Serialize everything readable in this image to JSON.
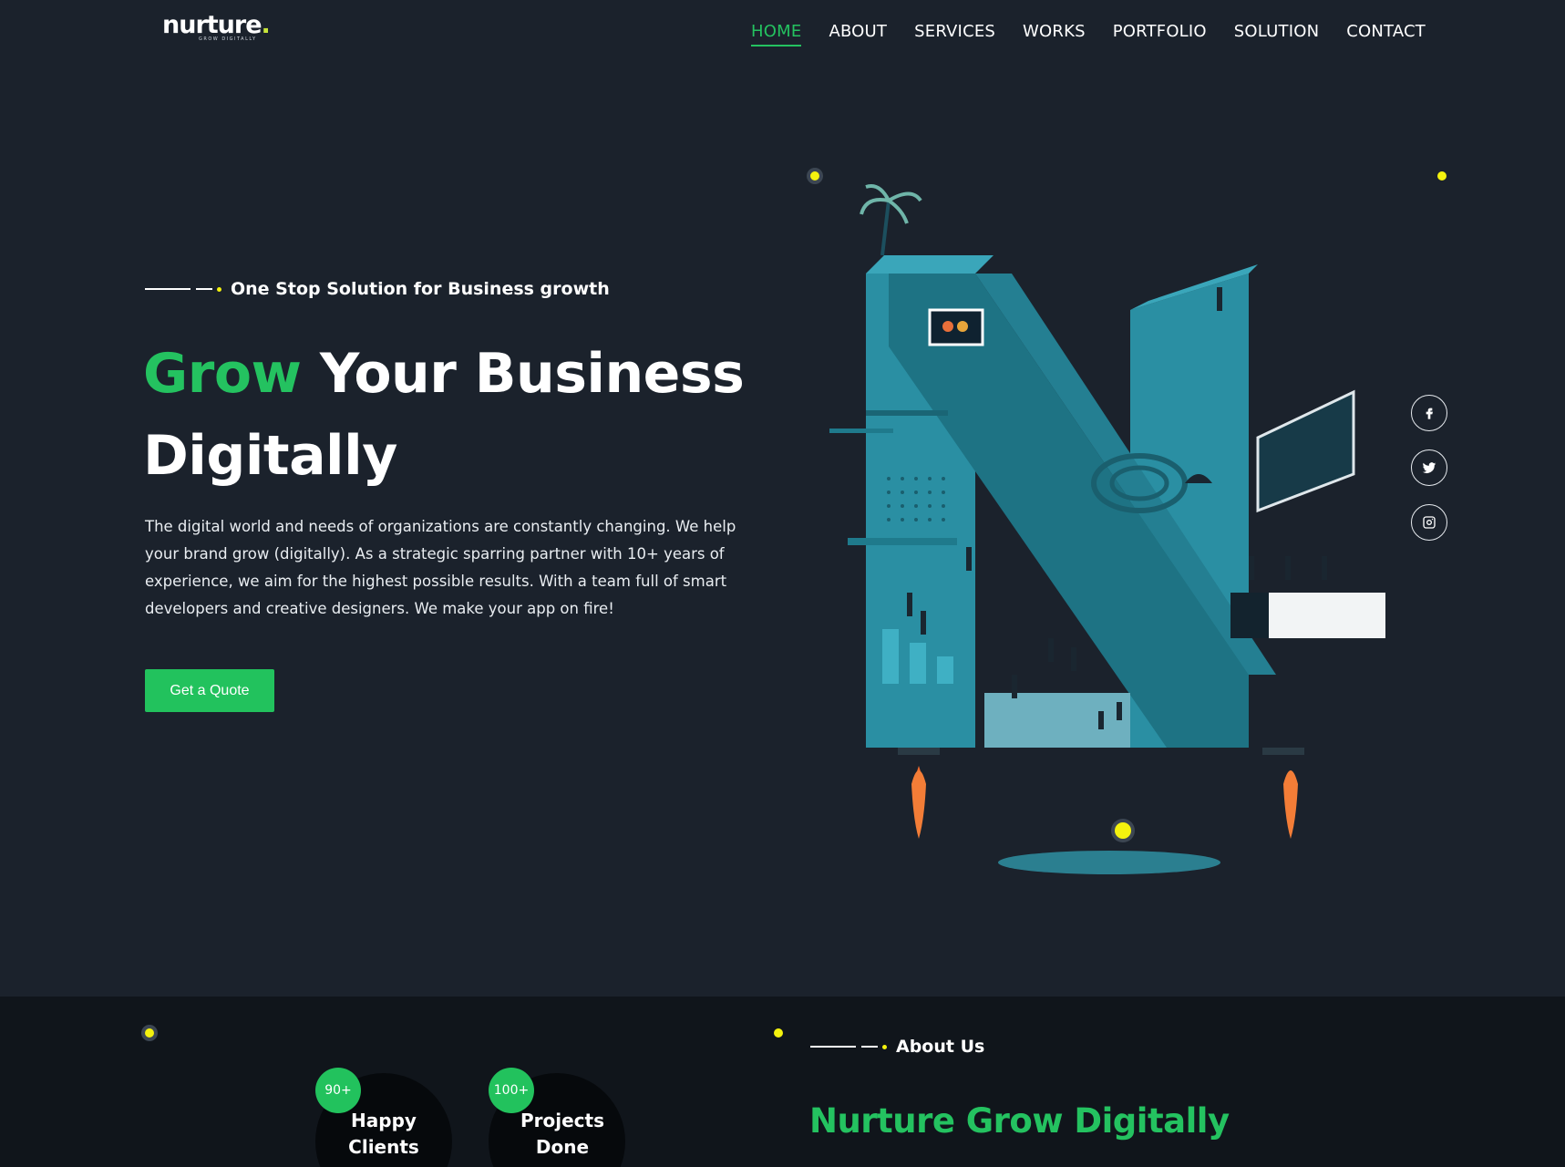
{
  "brand": {
    "name": "nurture",
    "dot": ".",
    "tagline": "GROW DIGITALLY"
  },
  "nav": {
    "items": [
      {
        "label": "HOME",
        "active": true
      },
      {
        "label": "ABOUT"
      },
      {
        "label": "SERVICES"
      },
      {
        "label": "WORKS"
      },
      {
        "label": "PORTFOLIO"
      },
      {
        "label": "SOLUTION"
      },
      {
        "label": "CONTACT"
      }
    ]
  },
  "hero": {
    "eyebrow": "One Stop Solution for Business growth",
    "title_accent": "Grow",
    "title_rest": "Your Business Digitally",
    "description": "The digital world and needs of organizations are constantly changing. We help your brand grow (digitally). As a strategic sparring partner with 10+ years of experience, we aim for the highest possible results. With a team full of smart developers and creative designers. We make your app on fire!",
    "cta": "Get a Quote"
  },
  "social": {
    "icons": [
      "facebook-icon",
      "twitter-icon",
      "instagram-icon"
    ]
  },
  "about": {
    "stats": [
      {
        "value": "90+",
        "label": "Happy Clients"
      },
      {
        "value": "100+",
        "label": "Projects Done"
      }
    ],
    "eyebrow": "About Us",
    "title": "Nurture Grow Digitally"
  },
  "colors": {
    "background": "#1b222c",
    "section_dark": "#10151b",
    "accent_green": "#24c260",
    "accent_yellow": "#f4f20e",
    "illustration_teal": "#2a8fa3"
  }
}
